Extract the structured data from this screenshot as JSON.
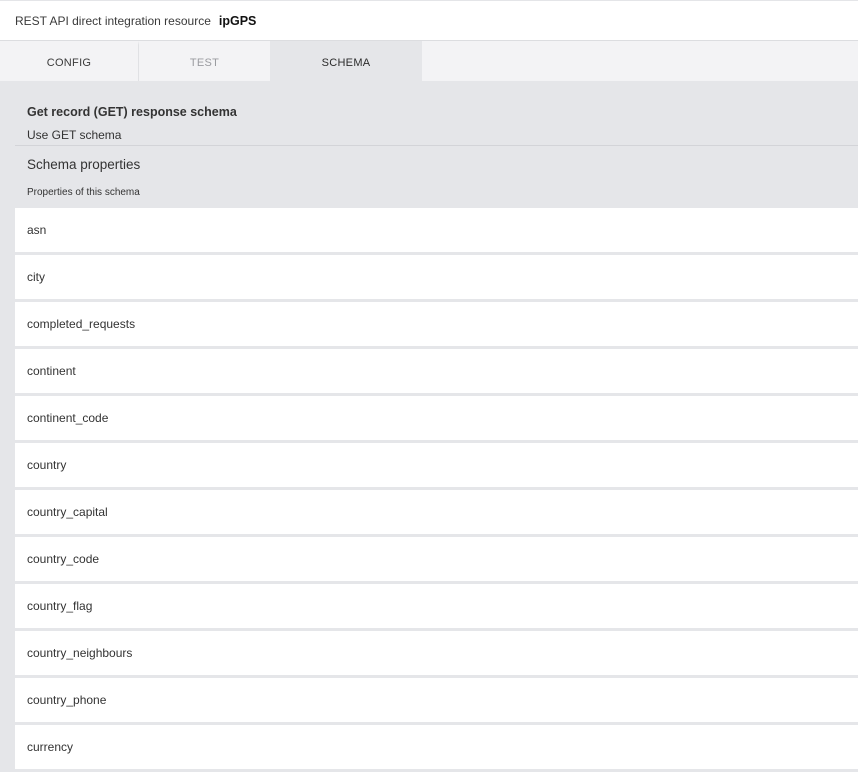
{
  "header": {
    "label": "REST API direct integration resource",
    "name": "ipGPS"
  },
  "tabs": {
    "config": "CONFIG",
    "test": "TEST",
    "schema": "SCHEMA",
    "active": "SCHEMA"
  },
  "schema": {
    "title": "Get record (GET) response schema",
    "use_label": "Use GET schema",
    "properties_heading": "Schema properties",
    "properties_sub": "Properties of this schema"
  },
  "properties": [
    "asn",
    "city",
    "completed_requests",
    "continent",
    "continent_code",
    "country",
    "country_capital",
    "country_code",
    "country_flag",
    "country_neighbours",
    "country_phone",
    "currency"
  ],
  "colors": {
    "panel_bg": "#e5e6e9",
    "tab_bar_bg": "#f3f3f5",
    "row_bg": "#ffffff",
    "text": "#333333",
    "muted_text": "#9a9ba0"
  }
}
